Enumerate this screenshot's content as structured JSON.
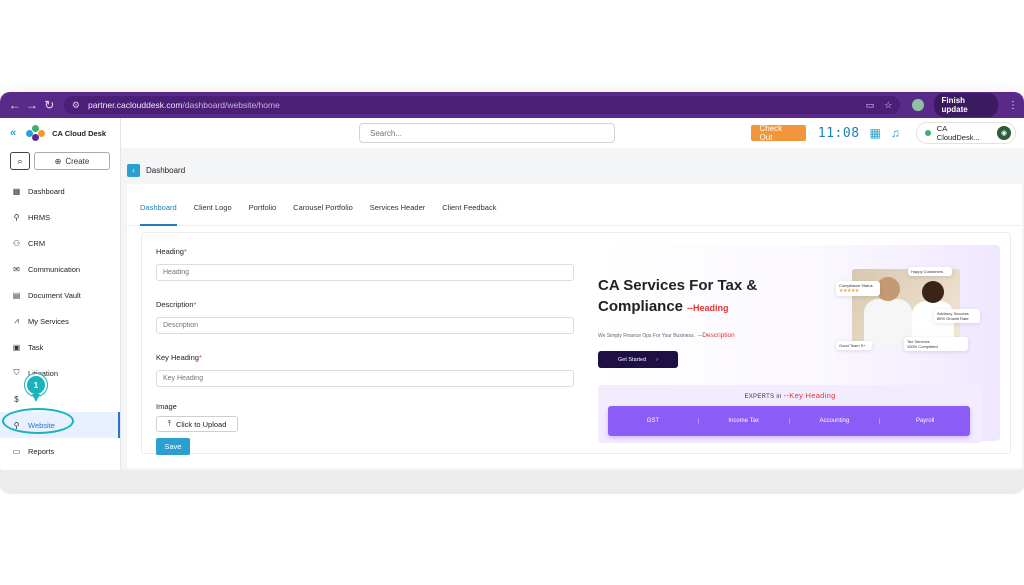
{
  "browser": {
    "url_host": "partner.caclouddesk.com",
    "url_path": "/dashboard/website/home",
    "finish_update": "Finish update"
  },
  "sidebar": {
    "brand": "CA Cloud Desk",
    "create_label": "Create",
    "items": [
      {
        "label": "Dashboard",
        "icon": "grid-icon"
      },
      {
        "label": "HRMS",
        "icon": "person-icon"
      },
      {
        "label": "CRM",
        "icon": "people-icon"
      },
      {
        "label": "Communication",
        "icon": "mail-icon"
      },
      {
        "label": "Document Vault",
        "icon": "document-icon"
      },
      {
        "label": "My Services",
        "icon": "chart-icon"
      },
      {
        "label": "Task",
        "icon": "clipboard-icon"
      },
      {
        "label": "Litigation",
        "icon": "shield-icon"
      },
      {
        "label": "",
        "icon": "dollar-icon"
      },
      {
        "label": "Website",
        "icon": "person-icon"
      },
      {
        "label": "Reports",
        "icon": "reports-icon"
      }
    ],
    "step_marker": "1"
  },
  "topbar": {
    "search_placeholder": "Search...",
    "checkout_label": "Check Out",
    "clock": "11:08",
    "profile_name": "CA CloudDesk..."
  },
  "breadcrumb": "Dashboard",
  "tabs": [
    "Dashboard",
    "Client Logo",
    "Portfolio",
    "Carousel Portfolio",
    "Services Header",
    "Client Feedback"
  ],
  "form": {
    "heading_label": "Heading",
    "heading_placeholder": "Heading",
    "description_label": "Description",
    "description_placeholder": "Description",
    "key_heading_label": "Key Heading",
    "key_heading_placeholder": "Key Heading",
    "image_label": "Image",
    "upload_label": "Click to Upload",
    "save_label": "Save"
  },
  "preview": {
    "title_line1": "CA Services For Tax &",
    "title_line2": "Compliance",
    "heading_tag": "--Heading",
    "description": "We Simply Finance Ops For Your Business.",
    "description_tag": "--Description",
    "cta": "Get Started",
    "badge_happy": "Happy Customers",
    "badge_compliance": "Compliance Status",
    "badge_advisory": "Advisory Success",
    "badge_growth": "85% Growth Rate",
    "badge_tax": "Tax Services",
    "badge_completed": "100% Completed",
    "badge_team": "Good Team 5+",
    "experts_title": "EXPERTS in",
    "experts_tag": "--Key Heading",
    "experts": [
      "GST",
      "Income Tax",
      "Accounting",
      "Payroll"
    ]
  }
}
